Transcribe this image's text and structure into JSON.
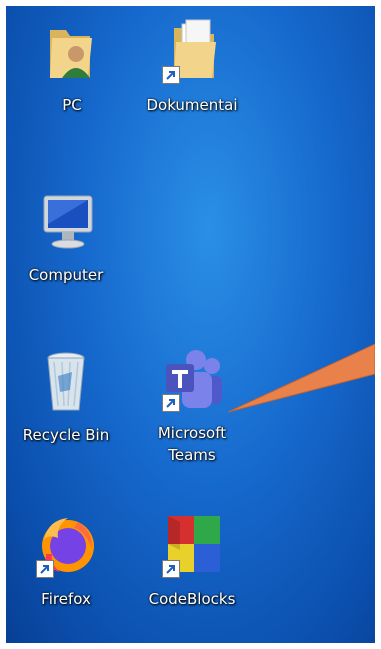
{
  "desktop": {
    "icons": [
      {
        "label": "PC",
        "icon": "user-folder-icon",
        "shortcut": false
      },
      {
        "label": "Dokumentai",
        "icon": "documents-folder-icon",
        "shortcut": true
      },
      {
        "label": "Computer",
        "icon": "computer-monitor-icon",
        "shortcut": false
      },
      {
        "label": "Recycle Bin",
        "icon": "recycle-bin-icon",
        "shortcut": false
      },
      {
        "label": "Microsoft\nTeams",
        "icon": "microsoft-teams-icon",
        "shortcut": true
      },
      {
        "label": "Firefox",
        "icon": "firefox-icon",
        "shortcut": true
      },
      {
        "label": "CodeBlocks",
        "icon": "codeblocks-icon",
        "shortcut": true
      }
    ],
    "callout": {
      "color": "#e8824a"
    }
  }
}
